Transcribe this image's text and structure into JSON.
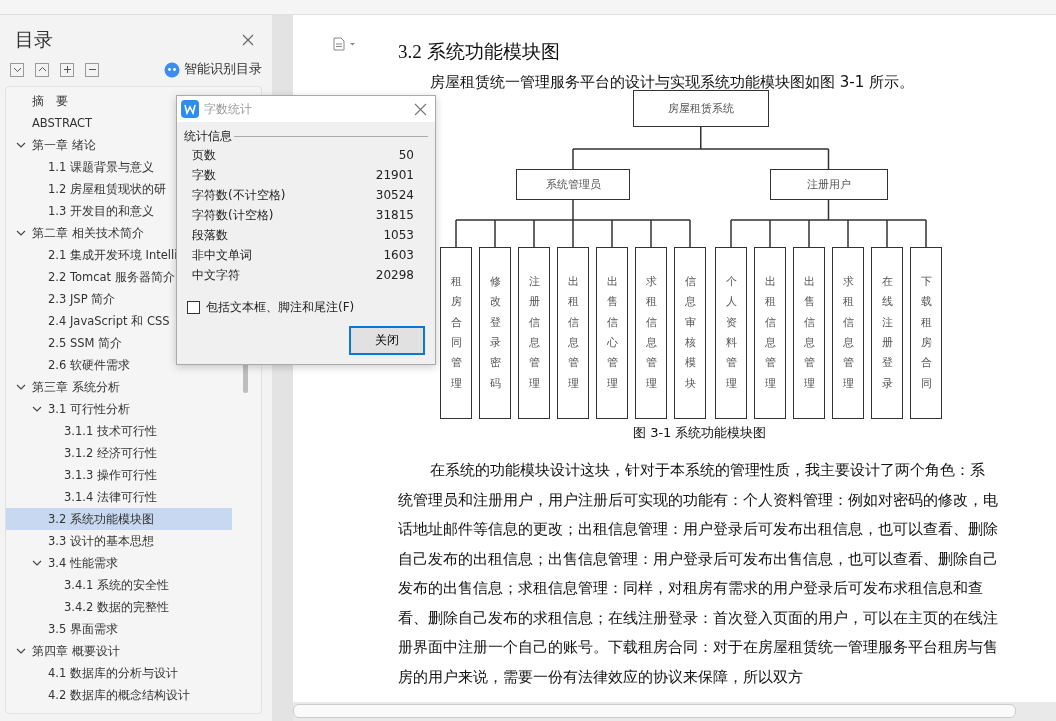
{
  "toc": {
    "title": "目录",
    "smart_button": "智能识别目录",
    "items": [
      {
        "label": "摘　要",
        "selected": false
      },
      {
        "label": "ABSTRACT",
        "selected": false
      },
      {
        "label": "第一章  绪论",
        "selected": false,
        "expanded": true,
        "children": [
          {
            "label": "1.1 课题背景与意义",
            "selected": false
          },
          {
            "label": "1.2 房屋租赁现状的研",
            "selected": false
          },
          {
            "label": "1.3 开发目的和意义",
            "selected": false
          }
        ]
      },
      {
        "label": "第二章  相关技术简介",
        "selected": false,
        "expanded": true,
        "children": [
          {
            "label": "2.1 集成开发环境 Intelli",
            "selected": false
          },
          {
            "label": "2.2 Tomcat 服务器简介",
            "selected": false
          },
          {
            "label": "2.3 JSP 简介",
            "selected": false
          },
          {
            "label": "2.4 JavaScript 和 CSS",
            "selected": false
          },
          {
            "label": "2.5 SSM 简介",
            "selected": false
          },
          {
            "label": "2.6 软硬件需求",
            "selected": false
          }
        ]
      },
      {
        "label": "第三章  系统分析",
        "selected": false,
        "expanded": true,
        "children": [
          {
            "label": "3.1 可行性分析",
            "selected": false,
            "expanded": true,
            "children": [
              {
                "label": "3.1.1 技术可行性",
                "selected": false
              },
              {
                "label": "3.1.2 经济可行性",
                "selected": false
              },
              {
                "label": "3.1.3 操作可行性",
                "selected": false
              },
              {
                "label": "3.1.4 法律可行性",
                "selected": false
              }
            ]
          },
          {
            "label": "3.2 系统功能模块图",
            "selected": true
          },
          {
            "label": "3.3 设计的基本思想",
            "selected": false
          },
          {
            "label": "3.4 性能需求",
            "selected": false,
            "expanded": true,
            "children": [
              {
                "label": "3.4.1 系统的安全性",
                "selected": false
              },
              {
                "label": "3.4.2 数据的完整性",
                "selected": false
              }
            ]
          },
          {
            "label": "3.5 界面需求",
            "selected": false
          }
        ]
      },
      {
        "label": "第四章  概要设计",
        "selected": false,
        "expanded": true,
        "children": [
          {
            "label": "4.1 数据库的分析与设计",
            "selected": false
          },
          {
            "label": "4.2 数据库的概念结构设计",
            "selected": false
          }
        ]
      }
    ]
  },
  "dialog": {
    "title": "字数统计",
    "group": "统计信息",
    "stats": [
      {
        "label": "页数",
        "value": "50"
      },
      {
        "label": "字数",
        "value": "21901"
      },
      {
        "label": "字符数(不计空格)",
        "value": "30524"
      },
      {
        "label": "字符数(计空格)",
        "value": "31815"
      },
      {
        "label": "段落数",
        "value": "1053"
      },
      {
        "label": "非中文单词",
        "value": "1603"
      },
      {
        "label": "中文字符",
        "value": "20298"
      }
    ],
    "checkbox": {
      "label": "包括文本框、脚注和尾注(F)",
      "checked": false
    },
    "button": "关闭"
  },
  "document": {
    "heading": "3.2 系统功能模块图",
    "intro": "房屋租赁统一管理服务平台的设计与实现系统功能模块图如图 3-1 所示。",
    "diagram": {
      "root": "房屋租赁系统",
      "groups": [
        {
          "label": "系统管理员",
          "leaves": [
            "租房合同管理",
            "修改登录密码",
            "注册信息管理",
            "出租信息管理",
            "出售信心管理",
            "求租信息管理",
            "信息审核模块"
          ]
        },
        {
          "label": "注册用户",
          "leaves": [
            "个人资料管理",
            "出租信息管理",
            "出售信息管理",
            "求租信息管理",
            "在线注册登录",
            "下载租房合同"
          ]
        }
      ]
    },
    "caption": "图 3-1 系统功能模块图",
    "paragraph": "在系统的功能模块设计这块，针对于本系统的管理性质，我主要设计了两个角色：系统管理员和注册用户，用户注册后可实现的功能有：个人资料管理：例如对密码的修改，电话地址邮件等信息的更改；出租信息管理：用户登录后可发布出租信息，也可以查看、删除自己发布的出租信息；出售信息管理：用户登录后可发布出售信息，也可以查看、删除自己发布的出售信息；求租信息管理：同样，对租房有需求的用户登录后可发布求租信息和查看、删除自己发布的求租信息；在线注册登录：首次登入页面的用户，可以在主页的在线注册界面中注册一个自己的账号。下载租房合同：对于在房屋租赁统一管理服务平台租房与售房的用户来说，需要一份有法律效应的协议来保障，所以双方"
  }
}
